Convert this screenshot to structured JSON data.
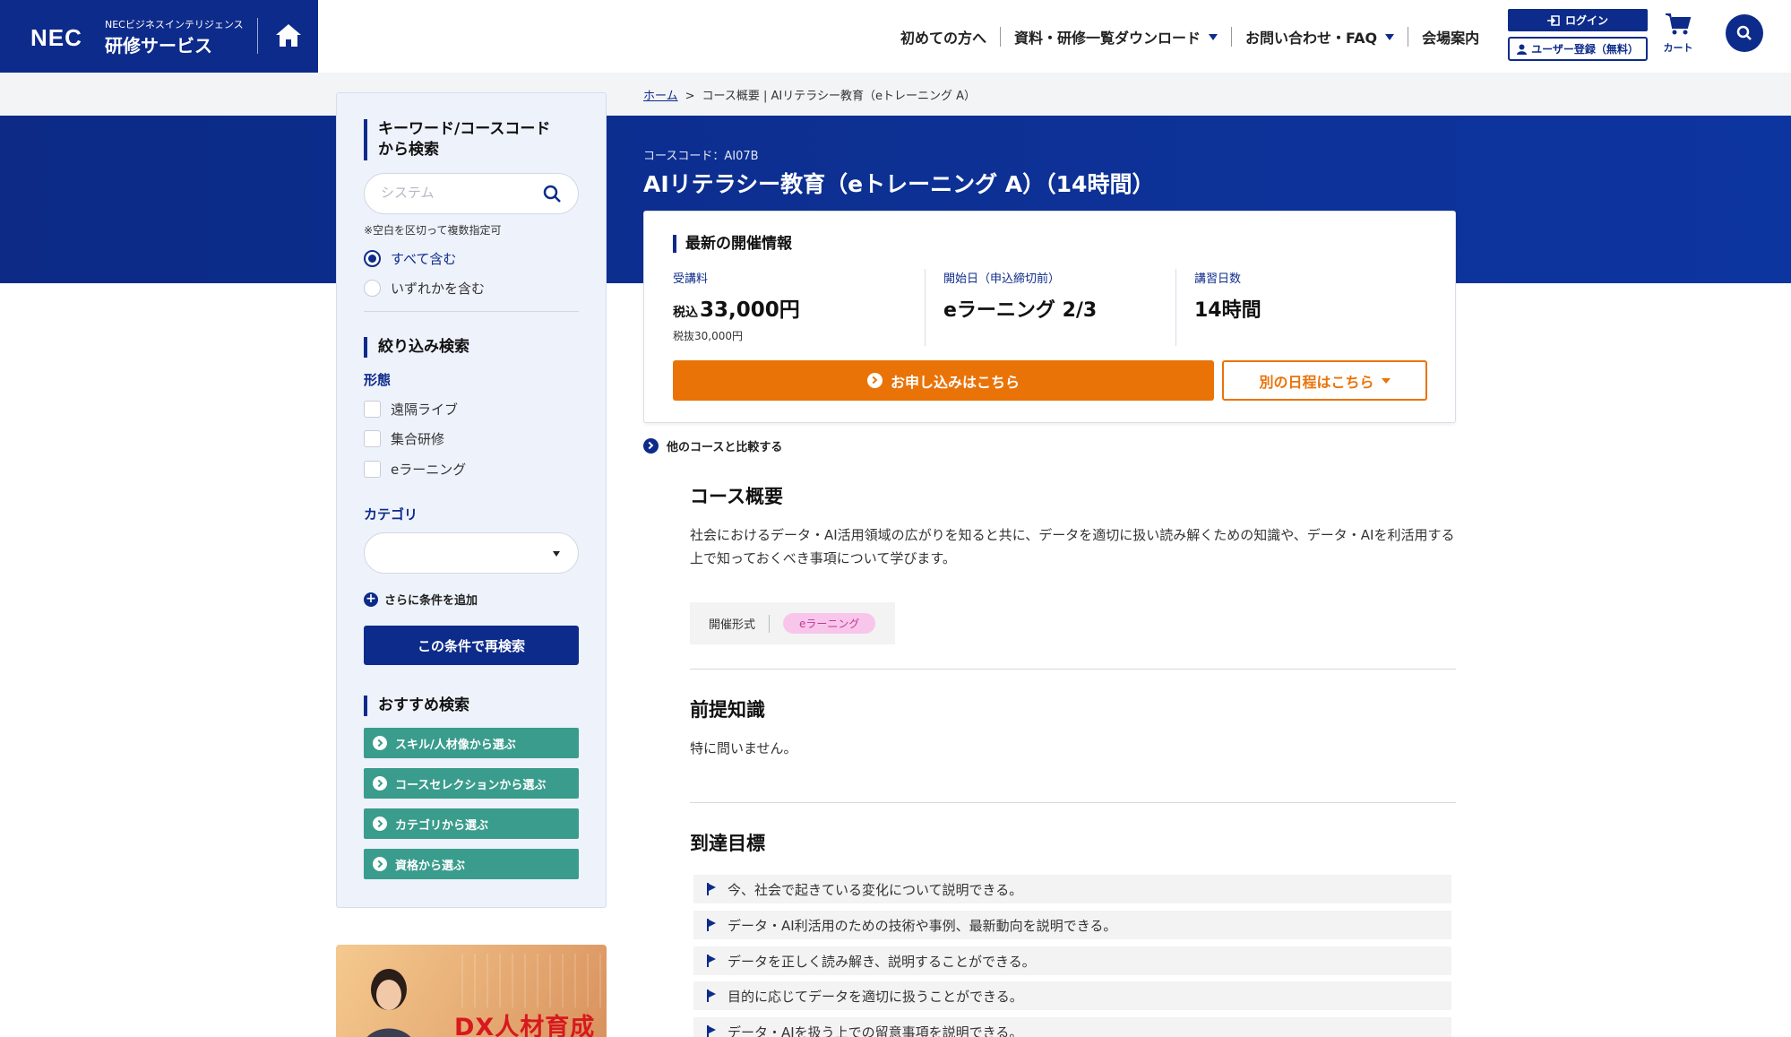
{
  "header": {
    "logo_nec": "NEC",
    "logo_small": "NECビジネスインテリジェンス",
    "logo_main": "研修サービス",
    "nav": [
      {
        "label": "初めての方へ",
        "dropdown": false
      },
      {
        "label": "資料・研修一覧ダウンロード",
        "dropdown": true
      },
      {
        "label": "お問い合わせ・FAQ",
        "dropdown": true
      },
      {
        "label": "会場案内",
        "dropdown": false
      }
    ],
    "login_label": "ログイン",
    "register_label": "ユーザー登録（無料）",
    "cart_label": "カート"
  },
  "sidebar": {
    "keyword_heading_line1": "キーワード/コースコード",
    "keyword_heading_line2": "から検索",
    "search_placeholder": "システム",
    "search_note": "※空白を区切って複数指定可",
    "radio_options": [
      {
        "label": "すべて含む",
        "selected": true
      },
      {
        "label": "いずれかを含む",
        "selected": false
      }
    ],
    "filter_heading": "絞り込み検索",
    "format_label": "形態",
    "format_options": [
      "遠隔ライブ",
      "集合研修",
      "eラーニング"
    ],
    "category_label": "カテゴリ",
    "category_value": "",
    "add_condition": "さらに条件を追加",
    "research_button": "この条件で再検索",
    "recommend_heading": "おすすめ検索",
    "recommend_buttons": [
      "スキル/人材像から選ぶ",
      "コースセレクションから選ぶ",
      "カテゴリから選ぶ",
      "資格から選ぶ"
    ],
    "promo_title": "DX人材育成"
  },
  "breadcrumb": {
    "home": "ホーム",
    "separator": ">",
    "current": "コース概要 | AIリテラシー教育（eトレーニング A）"
  },
  "course": {
    "code": "コースコード：AI07B",
    "title": "AIリテラシー教育（eトレーニング A）（14時間）"
  },
  "latest": {
    "heading": "最新の開催情報",
    "fee_label": "受講料",
    "fee_prefix": "税込",
    "fee_value": "33,000円",
    "fee_ex_tax": "税抜30,000円",
    "start_label": "開始日（申込締切前）",
    "start_value": "eラーニング 2/3",
    "days_label": "講習日数",
    "days_value": "14時間",
    "apply_button": "お申し込みはこちら",
    "other_button": "別の日程はこちら"
  },
  "compare_link": "他のコースと比較する",
  "overview": {
    "title": "コース概要",
    "text": "社会におけるデータ・AI活用領域の広がりを知ると共に、データを適切に扱い読み解くための知識や、データ・AIを利活用する上で知っておくべき事項について学びます。",
    "format_label": "開催形式",
    "format_tag": "eラーニング"
  },
  "prerequisite": {
    "title": "前提知識",
    "text": "特に問いません。"
  },
  "goals": {
    "title": "到達目標",
    "items": [
      "今、社会で起きている変化について説明できる。",
      "データ・AI利活用のための技術や事例、最新動向を説明できる。",
      "データを正しく読み解き、説明することができる。",
      "目的に応じてデータを適切に扱うことができる。",
      "データ・AIを扱う上での留意事項を説明できる。"
    ]
  },
  "colors": {
    "brand_navy": "#0d2b8a",
    "accent_orange": "#ea7308",
    "teal": "#3a9c8c"
  }
}
